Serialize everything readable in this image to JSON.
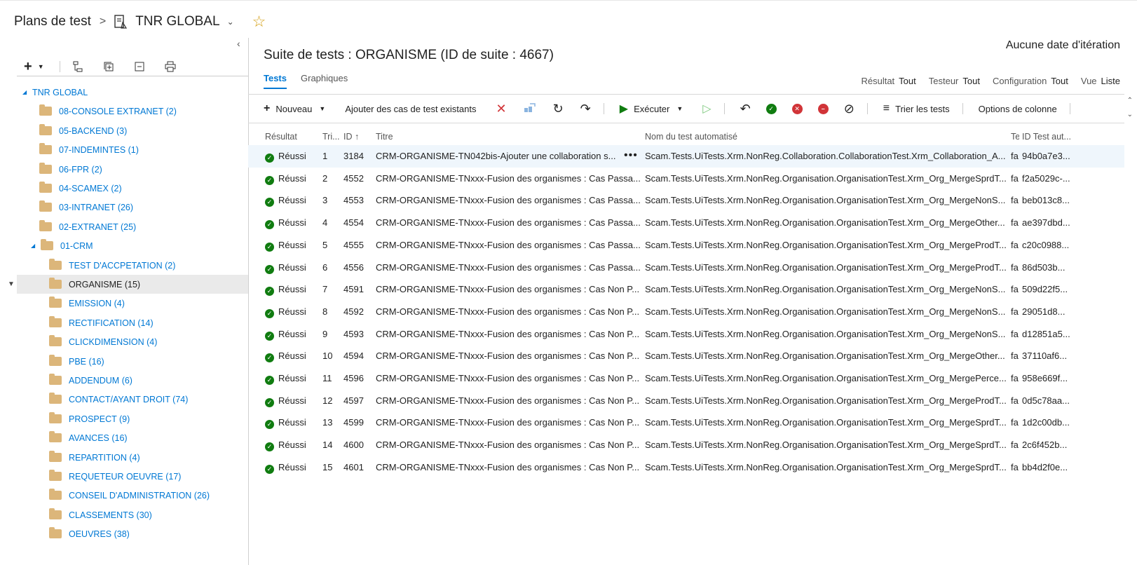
{
  "header": {
    "root": "Plans de test",
    "separator": ">",
    "plan_name": "TNR GLOBAL"
  },
  "tree": {
    "root": "TNR GLOBAL",
    "items": [
      {
        "label": "08-CONSOLE EXTRANET (2)",
        "level": 1
      },
      {
        "label": "05-BACKEND (3)",
        "level": 1
      },
      {
        "label": "07-INDEMINTES (1)",
        "level": 1
      },
      {
        "label": "06-FPR (2)",
        "level": 1
      },
      {
        "label": "04-SCAMEX (2)",
        "level": 1
      },
      {
        "label": "03-INTRANET (26)",
        "level": 1
      },
      {
        "label": "02-EXTRANET (25)",
        "level": 1
      },
      {
        "label": "01-CRM",
        "level": 1,
        "expanded": true
      },
      {
        "label": "TEST D'ACCPETATION (2)",
        "level": 2
      },
      {
        "label": "ORGANISME (15)",
        "level": 2,
        "selected": true
      },
      {
        "label": "EMISSION (4)",
        "level": 2
      },
      {
        "label": "RECTIFICATION (14)",
        "level": 2
      },
      {
        "label": "CLICKDIMENSION (4)",
        "level": 2
      },
      {
        "label": "PBE (16)",
        "level": 2
      },
      {
        "label": "ADDENDUM (6)",
        "level": 2
      },
      {
        "label": "CONTACT/AYANT DROIT (74)",
        "level": 2
      },
      {
        "label": "PROSPECT (9)",
        "level": 2
      },
      {
        "label": "AVANCES (16)",
        "level": 2
      },
      {
        "label": "REPARTITION (4)",
        "level": 2
      },
      {
        "label": "REQUETEUR OEUVRE (17)",
        "level": 2
      },
      {
        "label": "CONSEIL D'ADMINISTRATION (26)",
        "level": 2
      },
      {
        "label": "CLASSEMENTS (30)",
        "level": 2
      },
      {
        "label": "OEUVRES (38)",
        "level": 2
      }
    ]
  },
  "suite": {
    "title": "Suite de tests : ORGANISME (ID de suite : 4667)",
    "iteration": "Aucune date d'itération"
  },
  "tabs": [
    "Tests",
    "Graphiques"
  ],
  "filters": [
    {
      "label": "Résultat",
      "value": "Tout"
    },
    {
      "label": "Testeur",
      "value": "Tout"
    },
    {
      "label": "Configuration",
      "value": "Tout"
    },
    {
      "label": "Vue",
      "value": "Liste"
    }
  ],
  "toolbar": {
    "new": "Nouveau",
    "add_existing": "Ajouter des cas de test existants",
    "run": "Exécuter",
    "sort": "Trier les tests",
    "column_options": "Options de colonne"
  },
  "columns": [
    "Résultat",
    "Tri...",
    "ID",
    "Titre",
    "Nom du test automatisé",
    "Te",
    "ID Test aut..."
  ],
  "rows": [
    {
      "result": "Réussi",
      "order": "1",
      "id": "3184",
      "title": "CRM-ORGANISME-TN042bis-Ajouter une collaboration s...",
      "auto": "Scam.Tests.UiTests.Xrm.NonReg.Collaboration.CollaborationTest.Xrm_Collaboration_A...",
      "te": "fa",
      "auto_id": "94b0a7e3..."
    },
    {
      "result": "Réussi",
      "order": "2",
      "id": "4552",
      "title": "CRM-ORGANISME-TNxxx-Fusion des organismes : Cas Passa...",
      "auto": "Scam.Tests.UiTests.Xrm.NonReg.Organisation.OrganisationTest.Xrm_Org_MergeSprdT...",
      "te": "fa",
      "auto_id": "f2a5029c-..."
    },
    {
      "result": "Réussi",
      "order": "3",
      "id": "4553",
      "title": "CRM-ORGANISME-TNxxx-Fusion des organismes : Cas Passa...",
      "auto": "Scam.Tests.UiTests.Xrm.NonReg.Organisation.OrganisationTest.Xrm_Org_MergeNonS...",
      "te": "fa",
      "auto_id": "beb013c8..."
    },
    {
      "result": "Réussi",
      "order": "4",
      "id": "4554",
      "title": "CRM-ORGANISME-TNxxx-Fusion des organismes : Cas Passa...",
      "auto": "Scam.Tests.UiTests.Xrm.NonReg.Organisation.OrganisationTest.Xrm_Org_MergeOther...",
      "te": "fa",
      "auto_id": "ae397dbd..."
    },
    {
      "result": "Réussi",
      "order": "5",
      "id": "4555",
      "title": "CRM-ORGANISME-TNxxx-Fusion des organismes : Cas Passa...",
      "auto": "Scam.Tests.UiTests.Xrm.NonReg.Organisation.OrganisationTest.Xrm_Org_MergeProdT...",
      "te": "fa",
      "auto_id": "c20c0988..."
    },
    {
      "result": "Réussi",
      "order": "6",
      "id": "4556",
      "title": "CRM-ORGANISME-TNxxx-Fusion des organismes : Cas Passa...",
      "auto": "Scam.Tests.UiTests.Xrm.NonReg.Organisation.OrganisationTest.Xrm_Org_MergeProdT...",
      "te": "fa",
      "auto_id": "86d503b..."
    },
    {
      "result": "Réussi",
      "order": "7",
      "id": "4591",
      "title": "CRM-ORGANISME-TNxxx-Fusion des organismes : Cas Non P...",
      "auto": "Scam.Tests.UiTests.Xrm.NonReg.Organisation.OrganisationTest.Xrm_Org_MergeNonS...",
      "te": "fa",
      "auto_id": "509d22f5..."
    },
    {
      "result": "Réussi",
      "order": "8",
      "id": "4592",
      "title": "CRM-ORGANISME-TNxxx-Fusion des organismes : Cas Non P...",
      "auto": "Scam.Tests.UiTests.Xrm.NonReg.Organisation.OrganisationTest.Xrm_Org_MergeNonS...",
      "te": "fa",
      "auto_id": "29051d8..."
    },
    {
      "result": "Réussi",
      "order": "9",
      "id": "4593",
      "title": "CRM-ORGANISME-TNxxx-Fusion des organismes : Cas Non P...",
      "auto": "Scam.Tests.UiTests.Xrm.NonReg.Organisation.OrganisationTest.Xrm_Org_MergeNonS...",
      "te": "fa",
      "auto_id": "d12851a5..."
    },
    {
      "result": "Réussi",
      "order": "10",
      "id": "4594",
      "title": "CRM-ORGANISME-TNxxx-Fusion des organismes : Cas Non P...",
      "auto": "Scam.Tests.UiTests.Xrm.NonReg.Organisation.OrganisationTest.Xrm_Org_MergeOther...",
      "te": "fa",
      "auto_id": "37110af6..."
    },
    {
      "result": "Réussi",
      "order": "11",
      "id": "4596",
      "title": "CRM-ORGANISME-TNxxx-Fusion des organismes : Cas Non P...",
      "auto": "Scam.Tests.UiTests.Xrm.NonReg.Organisation.OrganisationTest.Xrm_Org_MergePerce...",
      "te": "fa",
      "auto_id": "958e669f..."
    },
    {
      "result": "Réussi",
      "order": "12",
      "id": "4597",
      "title": "CRM-ORGANISME-TNxxx-Fusion des organismes : Cas Non P...",
      "auto": "Scam.Tests.UiTests.Xrm.NonReg.Organisation.OrganisationTest.Xrm_Org_MergeProdT...",
      "te": "fa",
      "auto_id": "0d5c78aa..."
    },
    {
      "result": "Réussi",
      "order": "13",
      "id": "4599",
      "title": "CRM-ORGANISME-TNxxx-Fusion des organismes : Cas Non P...",
      "auto": "Scam.Tests.UiTests.Xrm.NonReg.Organisation.OrganisationTest.Xrm_Org_MergeSprdT...",
      "te": "fa",
      "auto_id": "1d2c00db..."
    },
    {
      "result": "Réussi",
      "order": "14",
      "id": "4600",
      "title": "CRM-ORGANISME-TNxxx-Fusion des organismes : Cas Non P...",
      "auto": "Scam.Tests.UiTests.Xrm.NonReg.Organisation.OrganisationTest.Xrm_Org_MergeSprdT...",
      "te": "fa",
      "auto_id": "2c6f452b..."
    },
    {
      "result": "Réussi",
      "order": "15",
      "id": "4601",
      "title": "CRM-ORGANISME-TNxxx-Fusion des organismes : Cas Non P...",
      "auto": "Scam.Tests.UiTests.Xrm.NonReg.Organisation.OrganisationTest.Xrm_Org_MergeSprdT...",
      "te": "fa",
      "auto_id": "bb4d2f0e..."
    }
  ],
  "colors": {
    "accent": "#0078d4",
    "pass": "#107c10",
    "fail": "#d13438",
    "folder": "#dcb67a"
  }
}
